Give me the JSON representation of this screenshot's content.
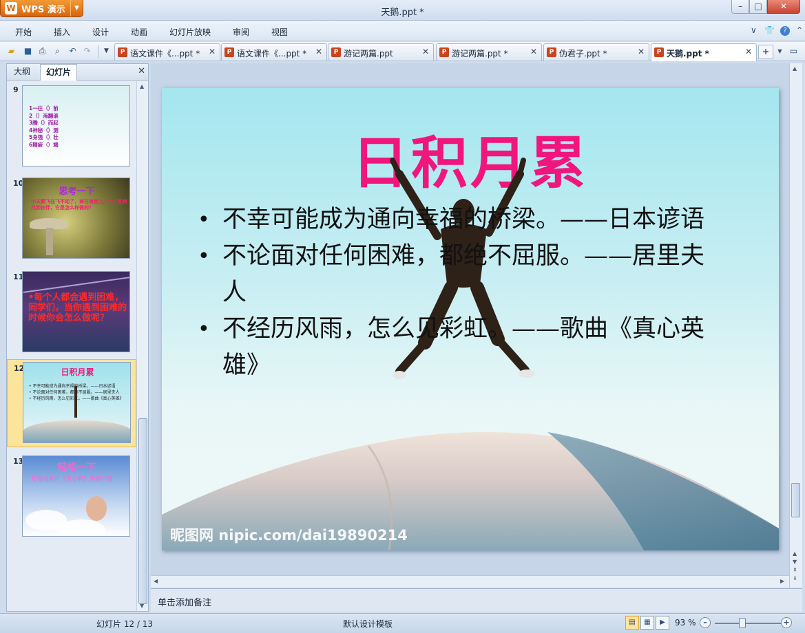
{
  "app": {
    "name": "WPS 演示",
    "document_title": "天鹅.ppt *"
  },
  "menu": [
    "开始",
    "插入",
    "设计",
    "动画",
    "幻灯片放映",
    "审阅",
    "视图"
  ],
  "doc_tabs": [
    {
      "label": "语文课件《...ppt *",
      "active": false
    },
    {
      "label": "语文课件《...ppt *",
      "active": false
    },
    {
      "label": "游记两篇.ppt",
      "active": false
    },
    {
      "label": "游记两篇.ppt *",
      "active": false
    },
    {
      "label": "伪君子.ppt *",
      "active": false
    },
    {
      "label": "天鹅.ppt *",
      "active": true
    }
  ],
  "left_pane": {
    "tabs": [
      "大纲",
      "幻灯片"
    ],
    "active_tab": "幻灯片",
    "thumbnails": [
      {
        "number": "9",
        "lines": [
          "1一往（）前",
          "2（）海翻滚",
          "3腾（）而起",
          "4神秘（）测",
          "5身强（）壮",
          "6精疲（）竭"
        ]
      },
      {
        "number": "10",
        "title": "思考一下",
        "body": "小天鹅飞在飞不动了，掉在海面上。为了能再找到伙伴，它是怎么样做的？"
      },
      {
        "number": "11",
        "body": "•每个人都会遇到困难，同学们，当你遇到困难的时候你会怎么做呢？"
      },
      {
        "number": "12",
        "title": "日积月累",
        "body": [
          "• 不幸可能成为通向幸福的桥梁。——日本谚语",
          "• 不论面对任何困难，都绝不屈服。——居里夫人",
          "• 不经历风雨，怎么见彩虹。——歌曲《真心英雄》"
        ],
        "selected": true
      },
      {
        "number": "13",
        "title": "轻松一下",
        "body": "观看动画片《丑小鸭》天鹅片段"
      }
    ]
  },
  "slide": {
    "title": "日积月累",
    "bullets": [
      "不幸可能成为通向幸福的桥梁。——日本谚语",
      "不论面对任何困难，都绝不屈服。——居里夫人",
      "不经历风雨，怎么见彩虹。——歌曲《真心英雄》"
    ],
    "watermark": "昵图网 nipic.com/dai19890214",
    "title_color": "#f0167d"
  },
  "notes": {
    "placeholder": "单击添加备注"
  },
  "status": {
    "slide_indicator": "幻灯片 12 / 13",
    "template": "默认设计模板",
    "zoom": "93 %"
  }
}
